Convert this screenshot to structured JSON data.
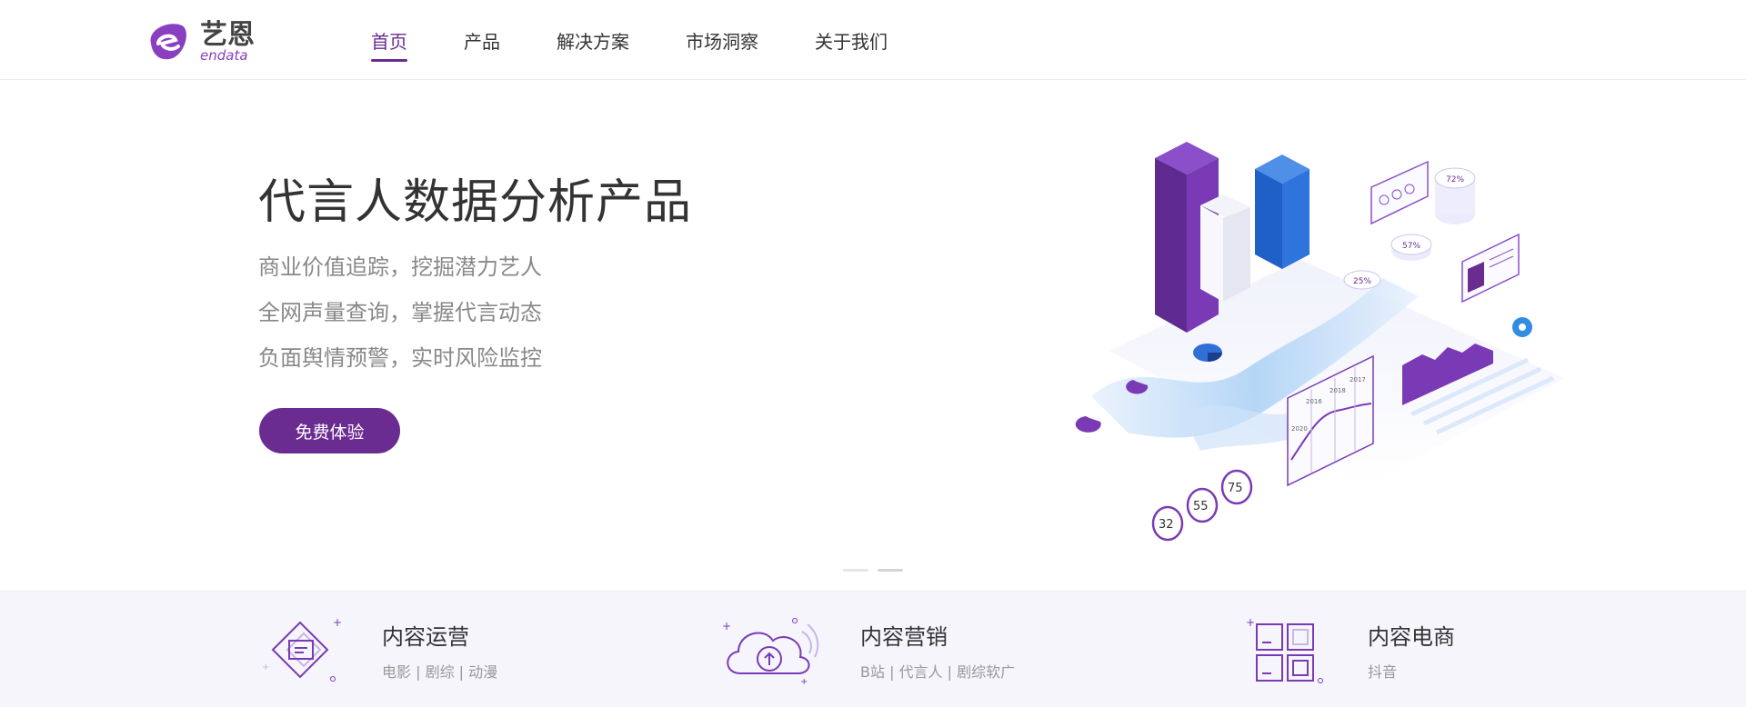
{
  "header": {
    "logo": {
      "cn": "艺恩",
      "en": "endata"
    },
    "nav": [
      {
        "label": "首页",
        "active": true
      },
      {
        "label": "产品",
        "active": false
      },
      {
        "label": "解决方案",
        "active": false
      },
      {
        "label": "市场洞察",
        "active": false
      },
      {
        "label": "关于我们",
        "active": false
      }
    ]
  },
  "hero": {
    "title": "代言人数据分析产品",
    "lines": [
      "商业价值追踪，挖掘潜力艺人",
      "全网声量查询，掌握代言动态",
      "负面舆情预警，实时风险监控"
    ],
    "cta_label": "免费体验",
    "illustration": {
      "labels": [
        "32",
        "55",
        "75",
        "25%",
        "57%",
        "72%",
        "2016",
        "2018",
        "2017",
        "2020"
      ]
    },
    "slides": 2,
    "active_slide": 1
  },
  "features": [
    {
      "title": "内容运营",
      "subtitle": "电影 | 剧综 | 动漫",
      "icon": "diamond-doc-icon"
    },
    {
      "title": "内容营销",
      "subtitle": "B站 | 代言人 | 剧综软广",
      "icon": "cloud-upload-icon"
    },
    {
      "title": "内容电商",
      "subtitle": "抖音",
      "icon": "grid-boxes-icon"
    }
  ],
  "colors": {
    "brand": "#6b2c91",
    "blue": "#2f6fd6",
    "feature_bg": "#f5f5fb"
  }
}
